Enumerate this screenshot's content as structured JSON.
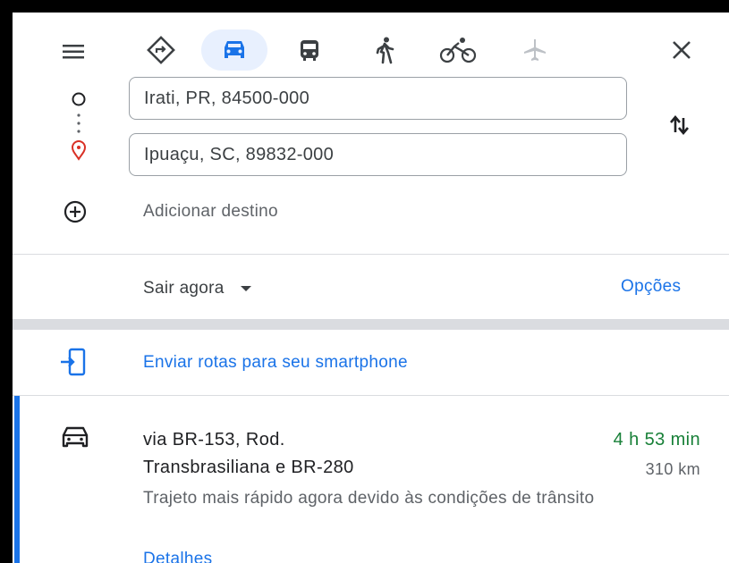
{
  "header": {
    "modes": [
      "driving-directions",
      "car",
      "transit",
      "walking",
      "cycling",
      "flight"
    ],
    "active_mode": "car"
  },
  "route": {
    "origin": "Irati, PR, 84500-000",
    "destination": "Ipuaçu, SC, 89832-000",
    "add_destination": "Adicionar destino"
  },
  "options": {
    "depart_label": "Sair agora",
    "options_link": "Opções"
  },
  "send": {
    "label": "Enviar rotas para seu smartphone"
  },
  "result": {
    "via_line1": "via BR-153, Rod.",
    "via_line2": "Transbrasiliana e BR-280",
    "duration": "4 h 53 min",
    "distance": "310 km",
    "description": "Trajeto mais rápido agora devido às condições de trânsito",
    "details_link": "Detalhes"
  },
  "colors": {
    "accent": "#1a73e8",
    "duration_green": "#188038",
    "origin_marker": "#202124",
    "destination_marker": "#d93025"
  }
}
